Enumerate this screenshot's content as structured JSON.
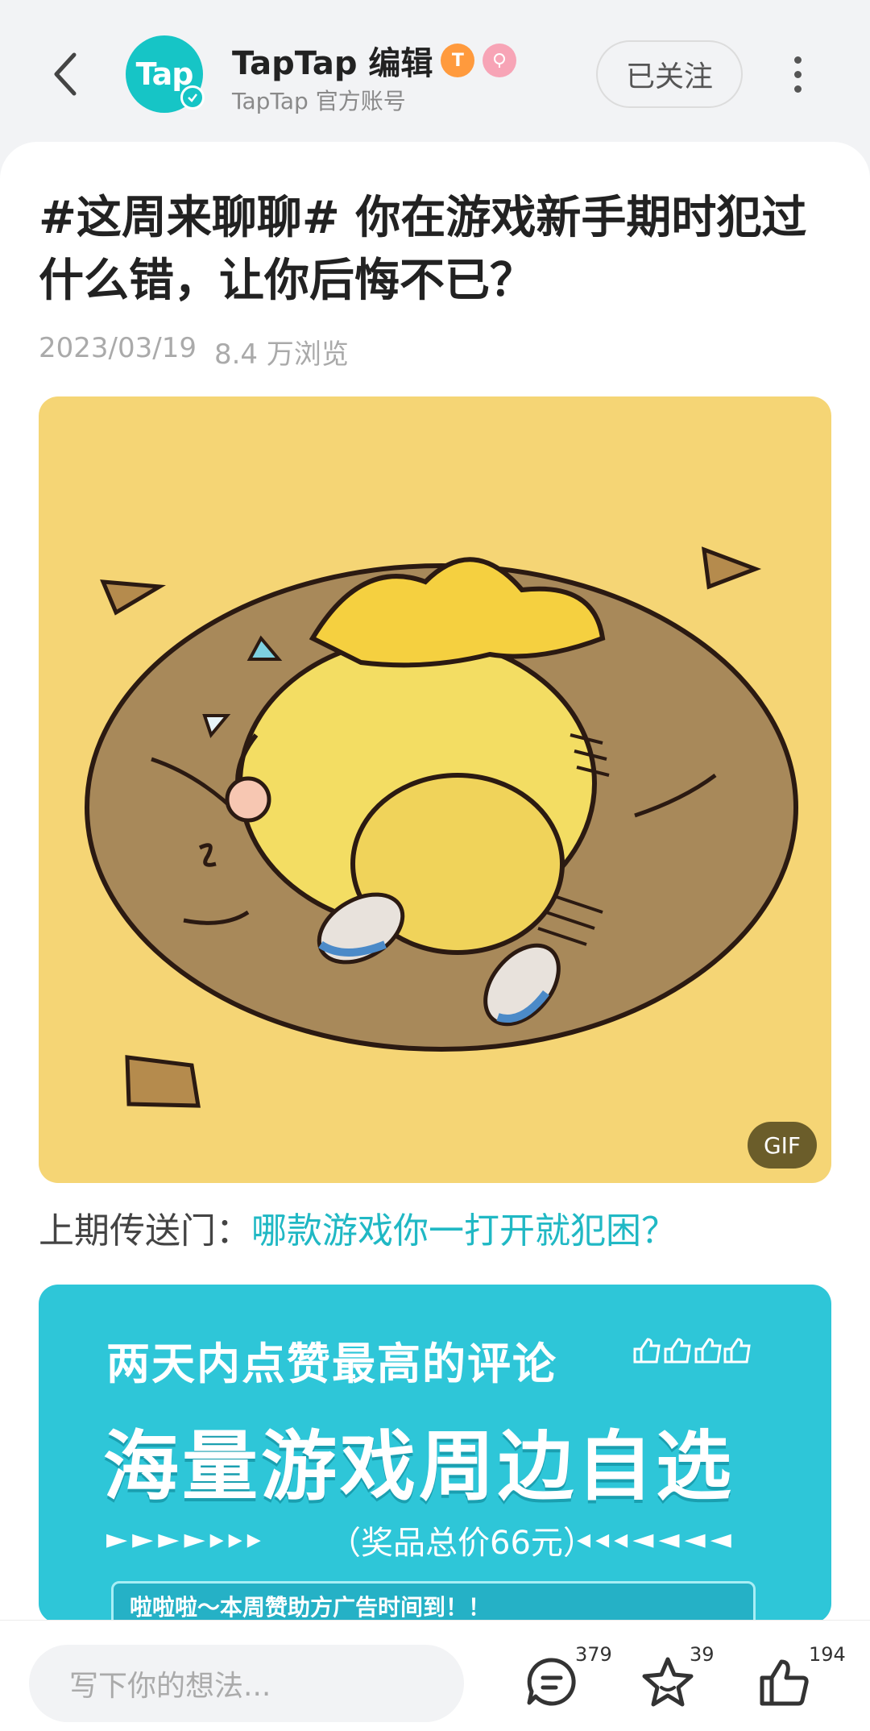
{
  "header": {
    "back_icon": "chevron-left-icon",
    "avatar_text": "Tap",
    "author_name": "TapTap 编辑",
    "level_badge": "T",
    "author_subtitle": "TapTap 官方账号",
    "follow_label": "已关注",
    "more_icon": "more-vertical-icon"
  },
  "post": {
    "title": "#这周来聊聊# 你在游戏新手期时犯过什么错，让你后悔不已？",
    "date": "2023/03/19",
    "views": "8.4 万浏览",
    "gif_tag": "GIF",
    "portal_label": "上期传送门：",
    "portal_link": "哪款游戏你一打开就犯困？"
  },
  "banner": {
    "line1": "两天内点赞最高的评论",
    "line2": "海量游戏周边自选",
    "prize": "（奖品总价66元）",
    "arrows_left": "►►►►▸▸▸",
    "arrows_right": "◂◂◂◄◄◄◄",
    "box_text": "啦啦啦～本周赞助方广告时间到！！"
  },
  "bottom_bar": {
    "input_placeholder": "写下你的想法...",
    "comment_count": "379",
    "favorite_count": "39",
    "like_count": "194"
  },
  "colors": {
    "accent": "#16c5c6",
    "link": "#20b8c4",
    "banner": "#2ec6d8",
    "gif_bg": "#f5d575"
  }
}
